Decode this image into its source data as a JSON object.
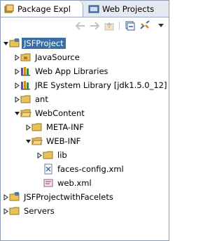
{
  "tabs": [
    {
      "label": "Package Expl",
      "icon": "package-explorer-icon",
      "active": true
    },
    {
      "label": "Web Projects",
      "icon": "web-projects-icon",
      "active": false
    }
  ],
  "toolbar": [
    {
      "name": "back-button",
      "enabled": false
    },
    {
      "name": "forward-button",
      "enabled": false
    },
    {
      "name": "up-button",
      "enabled": false
    },
    {
      "name": "collapse-all-button",
      "enabled": true
    },
    {
      "name": "link-with-editor-button",
      "enabled": true
    },
    {
      "name": "view-menu-button",
      "enabled": true
    }
  ],
  "tree": [
    {
      "label": "JSFProject",
      "icon": "project-icon",
      "state": "expanded",
      "selected": true
    },
    {
      "label": "JavaSource",
      "icon": "source-folder-icon",
      "state": "collapsed"
    },
    {
      "label": "Web App Libraries",
      "icon": "library-icon",
      "state": "collapsed"
    },
    {
      "label": "JRE System Library [jdk1.5.0_12]",
      "icon": "library-icon",
      "state": "collapsed"
    },
    {
      "label": "ant",
      "icon": "folder-icon",
      "state": "collapsed"
    },
    {
      "label": "WebContent",
      "icon": "folder-icon",
      "state": "expanded"
    },
    {
      "label": "META-INF",
      "icon": "folder-icon",
      "state": "collapsed"
    },
    {
      "label": "WEB-INF",
      "icon": "folder-icon",
      "state": "expanded"
    },
    {
      "label": "lib",
      "icon": "folder-icon",
      "state": "collapsed"
    },
    {
      "label": "faces-config.xml",
      "icon": "faces-config-file-icon",
      "state": "leaf"
    },
    {
      "label": "web.xml",
      "icon": "web-xml-file-icon",
      "state": "leaf"
    },
    {
      "label": "JSFProjectwithFacelets",
      "icon": "project-icon",
      "state": "collapsed"
    },
    {
      "label": "Servers",
      "icon": "folder-icon",
      "state": "collapsed"
    }
  ],
  "colors": {
    "selection": "#3a6ea5",
    "folder": "#e8c25a",
    "tab_bg": "#e4e9f2"
  }
}
